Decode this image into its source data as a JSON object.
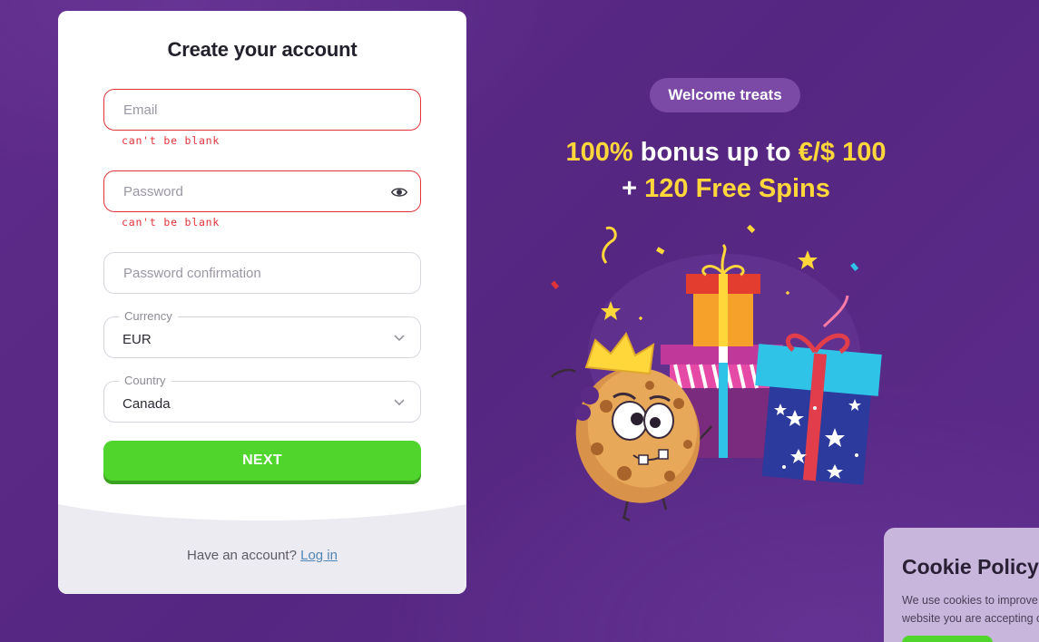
{
  "form": {
    "title": "Create your account",
    "email": {
      "placeholder": "Email",
      "error": "can't be blank"
    },
    "password": {
      "placeholder": "Password",
      "error": "can't be blank"
    },
    "password_confirmation": {
      "placeholder": "Password confirmation"
    },
    "currency": {
      "label": "Currency",
      "value": "EUR"
    },
    "country": {
      "label": "Country",
      "value": "Canada"
    },
    "next_label": "NEXT",
    "footer": {
      "question": "Have an account?",
      "login_link": "Log in"
    }
  },
  "promo": {
    "pill": "Welcome treats",
    "line1_a": "100%",
    "line1_b": " bonus up to ",
    "line1_c": "€/$ 100",
    "line2_a": "+ ",
    "line2_b": "120 Free Spins"
  },
  "cookie": {
    "title": "Cookie Policy",
    "text_line1": "We use cookies to improve",
    "text_line2": "website you are accepting c"
  },
  "colors": {
    "background": "#5b2a86",
    "accent_green": "#4fd52c",
    "error_red": "#e2333a",
    "gold": "#ffd73a",
    "link": "#4f86b8"
  },
  "icons": [
    "eye-icon",
    "chevron-down-icon",
    "cookie-mascot-illustration",
    "gift-boxes-illustration"
  ]
}
